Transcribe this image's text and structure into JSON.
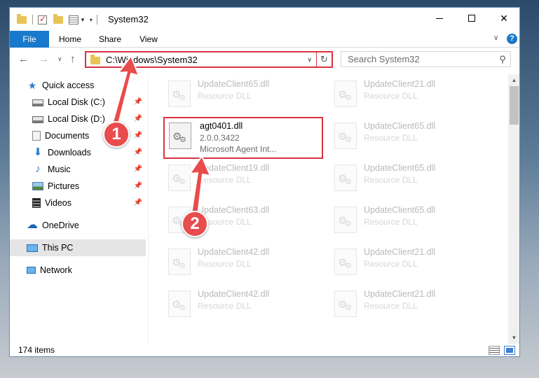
{
  "window": {
    "title": "System32",
    "minimize_label": "",
    "close_label": "✕"
  },
  "ribbon": {
    "tabs": [
      {
        "label": "File"
      },
      {
        "label": "Home"
      },
      {
        "label": "Share"
      },
      {
        "label": "View"
      }
    ],
    "expand_icon": "chevron-down-icon",
    "help_label": "?"
  },
  "address": {
    "path": "C:\\Windows\\System32",
    "refresh_icon": "refresh-icon"
  },
  "search": {
    "placeholder": "Search System32"
  },
  "sidebar": {
    "items": [
      {
        "label": "Quick access",
        "icon": "star-icon"
      },
      {
        "label": "Local Disk (C:)",
        "icon": "drive-icon",
        "pinned": true
      },
      {
        "label": "Local Disk (D:)",
        "icon": "drive-icon",
        "pinned": true
      },
      {
        "label": "Documents",
        "icon": "documents-icon",
        "pinned": true
      },
      {
        "label": "Downloads",
        "icon": "download-icon",
        "pinned": true
      },
      {
        "label": "Music",
        "icon": "music-icon",
        "pinned": true
      },
      {
        "label": "Pictures",
        "icon": "pictures-icon",
        "pinned": true
      },
      {
        "label": "Videos",
        "icon": "video-icon",
        "pinned": true
      },
      {
        "label": "OneDrive",
        "icon": "cloud-icon"
      },
      {
        "label": "This PC",
        "icon": "computer-icon",
        "selected": true
      },
      {
        "label": "Network",
        "icon": "network-icon"
      }
    ]
  },
  "files": {
    "left": [
      {
        "name": "UpdateClient65.dll",
        "type": "Resource DLL"
      },
      {
        "name": "agt0401.dll",
        "version": "2.0.0.3422",
        "description": "Microsoft Agent Int..."
      },
      {
        "name": "UpdateClient19.dll",
        "type": "Resource DLL"
      },
      {
        "name": "UpdateClient63.dll",
        "type": "Resource DLL"
      },
      {
        "name": "UpdateClient42.dll",
        "type": "Resource DLL"
      },
      {
        "name": "UpdateClient42.dll",
        "type": "Resource DLL"
      }
    ],
    "right": [
      {
        "name": "UpdateClient21.dll",
        "type": "Resource DLL"
      },
      {
        "name": "UpdateClient65.dll",
        "type": "Resource DLL"
      },
      {
        "name": "UpdateClient65.dll",
        "type": "Resource DLL"
      },
      {
        "name": "UpdateClient65.dll",
        "type": "Resource DLL"
      },
      {
        "name": "UpdateClient21.dll",
        "type": "Resource DLL"
      },
      {
        "name": "UpdateClient21.dll",
        "type": "Resource DLL"
      }
    ]
  },
  "status": {
    "item_count": "174 items"
  },
  "annotations": {
    "step1": "1",
    "step2": "2",
    "color": "#e84c4c"
  }
}
